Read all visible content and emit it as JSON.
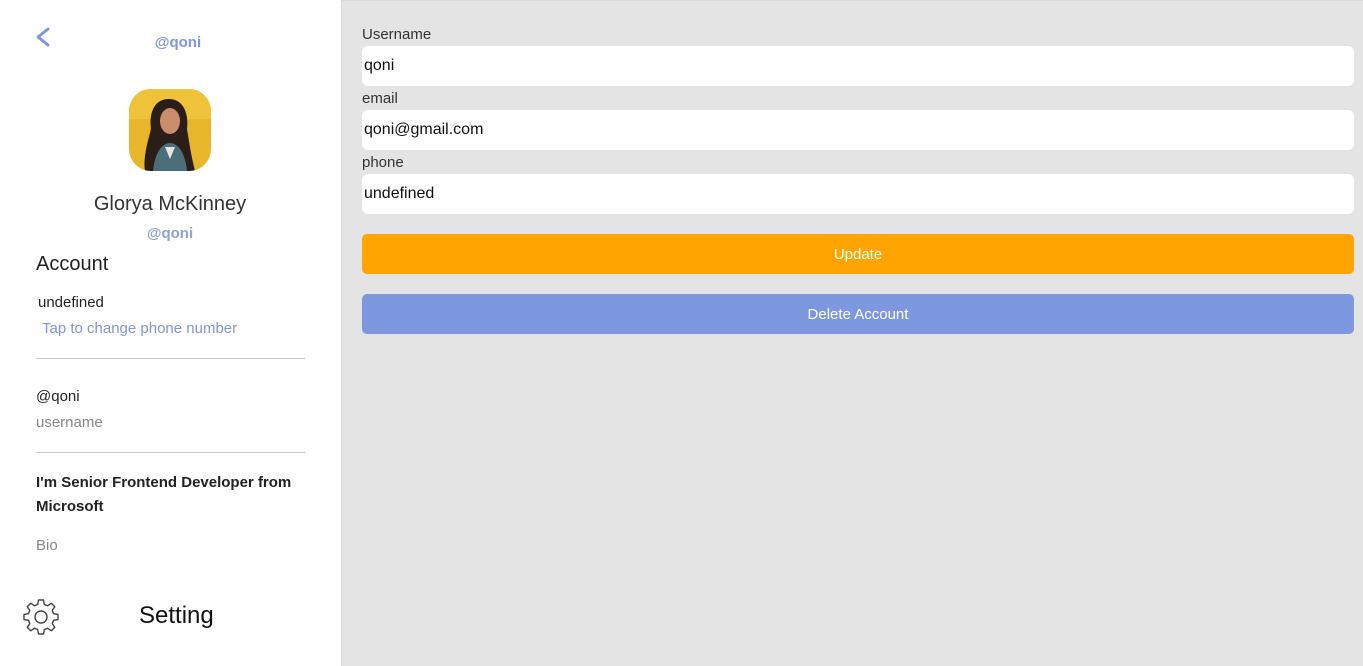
{
  "sidebar": {
    "header_handle": "@qoni",
    "display_name": "Glorya McKinney",
    "sub_handle": "@qoni",
    "section_title": "Account",
    "phone_value": "undefined",
    "phone_link": "Tap to change phone number",
    "username_value": "@qoni",
    "username_label": "username",
    "bio_text": "I'm Senior Frontend Developer from Microsoft",
    "bio_label": "Bio",
    "setting_label": "Setting"
  },
  "form": {
    "username_label": "Username",
    "username_value": "qoni",
    "email_label": "email",
    "email_value": "qoni@gmail.com",
    "phone_label": "phone",
    "phone_value": "undefined",
    "update_label": "Update",
    "delete_label": "Delete Account"
  },
  "colors": {
    "accent": "#7f96dd",
    "update": "#ffa400",
    "delete": "#7e98e0",
    "background": "#e4e4e4"
  },
  "icons": {
    "back": "chevron-left-icon",
    "settings": "gear-icon"
  }
}
